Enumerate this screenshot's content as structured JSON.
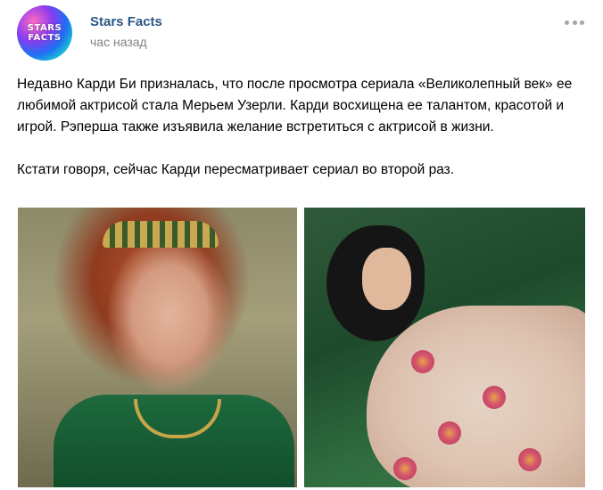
{
  "post": {
    "author": "Stars Facts",
    "time": "час назад",
    "avatar_logo_lines": [
      "STARS",
      "FACTS"
    ],
    "more_icon": "ellipsis-icon",
    "paragraphs": [
      "Недавно Карди Би призналась, что после просмотра сериала «Великолепный век» ее любимой актрисой стала Мерьем Узерли. Карди восхищена ее талантом, красотой и игрой. Рэперша также изъявила желание встретиться с актрисой в жизни.",
      "Кстати говоря, сейчас Карди пересматривает сериал во второй раз."
    ],
    "photos": [
      {
        "subject": "woman-in-crown-green-dress"
      },
      {
        "subject": "woman-on-green-sofa"
      }
    ]
  },
  "colors": {
    "author_link": "#2a5885",
    "time_text": "#828282",
    "more_dots": "#a0a6ae"
  }
}
